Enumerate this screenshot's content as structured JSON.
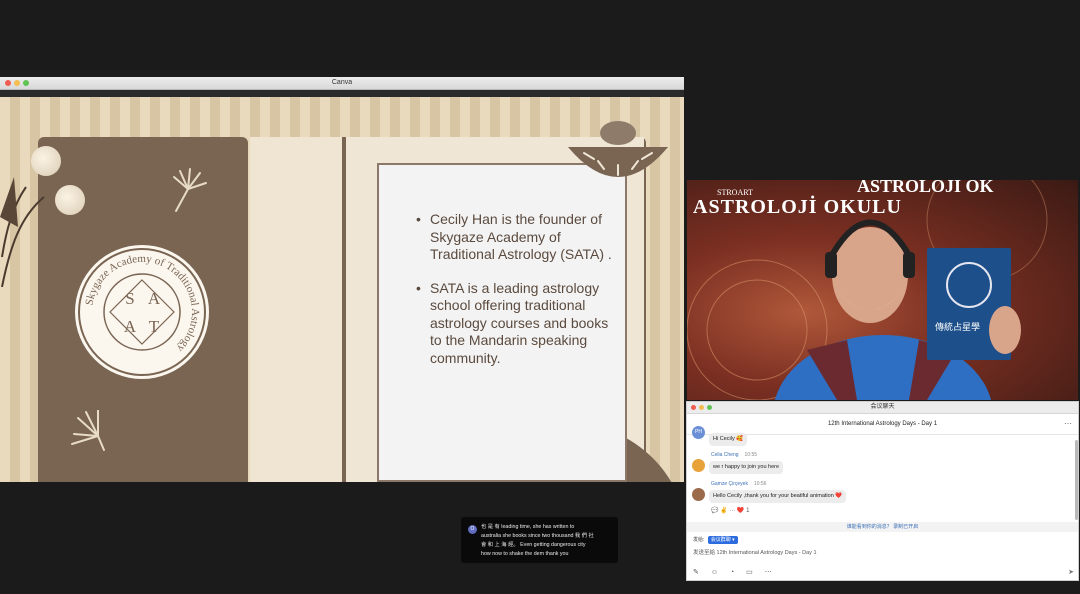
{
  "canva": {
    "window_title": "Canva",
    "slide": {
      "bullets": [
        "Cecily Han is the founder of Skygaze Academy of Traditional Astrology (SATA) .",
        "SATA is a leading astrology school offering traditional astrology courses and books to the Mandarin speaking community."
      ],
      "logo": {
        "ring_text": "Skygaze Academy of Traditional Astrology",
        "letters": [
          "S",
          "A",
          "A",
          "T"
        ]
      }
    }
  },
  "video": {
    "banner_text": "ASTROLOJİ OKULU",
    "banner_small": "STROART",
    "banner_right": "ASTROLOJI OK",
    "book_title": "傳統占星學"
  },
  "chat": {
    "window_title": "会议聊天",
    "header_title": "12th International Astrology Days - Day 1",
    "messages": [
      {
        "initials": "PH",
        "sender": "",
        "time": "",
        "text": "Hi Cecily 🥰"
      },
      {
        "initials": "",
        "sender": "Celia Cheng",
        "time": "10:55",
        "text": "we r happy to join you here"
      },
      {
        "initials": "",
        "sender": "Gamze Çirçeyek",
        "time": "10:56",
        "text": "Hello Cecily ,thank you for your beatiful animation ❤️"
      }
    ],
    "reactions": "💬 ✌ ··· ❤️ 1",
    "notice": "谁能看到你的消息？ 录制已开启",
    "send_to_label": "发给:",
    "send_to_value": "会议群聊 ▾",
    "compose_placeholder": "发送至給 12th International Astrology Days - Day 1",
    "toolbar_icons": [
      "format-icon",
      "emoji-icon",
      "screenshot-icon",
      "file-icon",
      "more-icon"
    ]
  },
  "caption": {
    "icon_letter": "O",
    "text": "也 是 有 leading time,   she has written to\naustralia she books since two thousand 我 們 社\n會 和 上 海 經。 Even getting dangerous city\nhow now to shake the dem thank you"
  },
  "colors": {
    "slide_brown": "#7a6553",
    "slide_cream": "#efe6d6",
    "chat_link_blue": "#3b6fb6",
    "chip_blue": "#2d6cdf",
    "background": "#1b1b1b"
  }
}
